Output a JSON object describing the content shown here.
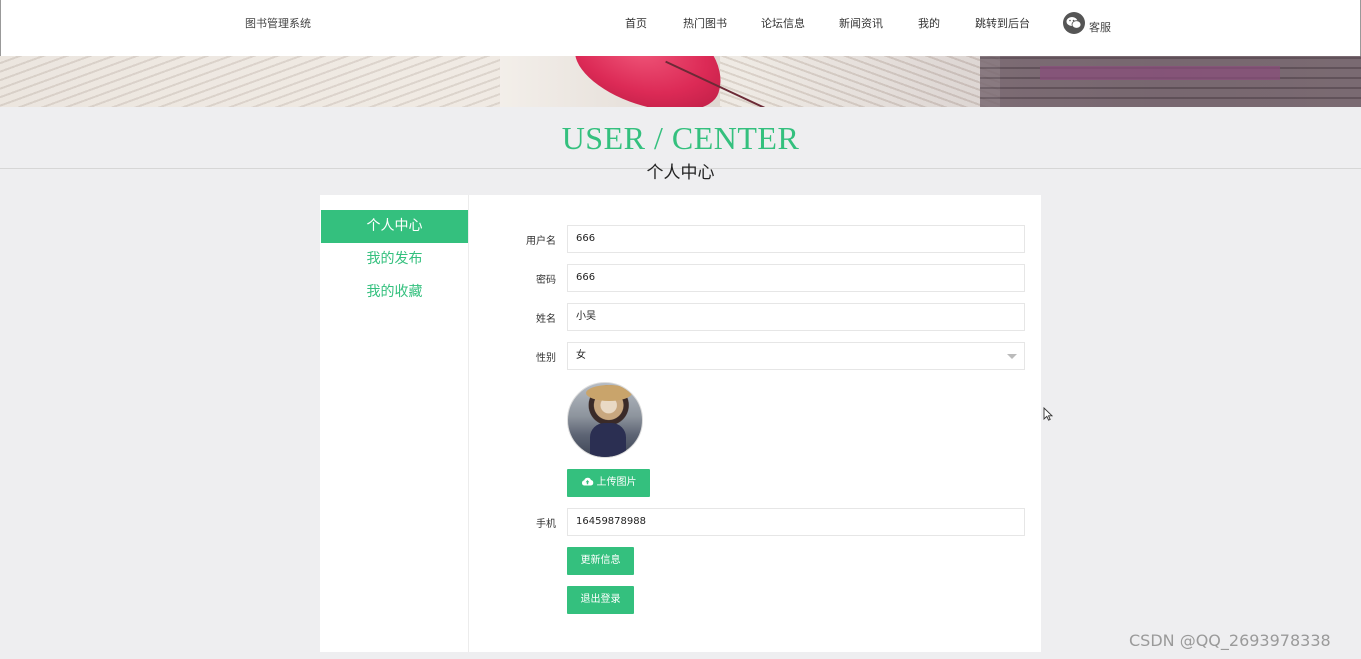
{
  "header": {
    "site_title": "图书管理系统",
    "nav": [
      "首页",
      "热门图书",
      "论坛信息",
      "新闻资讯",
      "我的",
      "跳转到后台"
    ],
    "service_label": "客服",
    "service_icon": "wechat-icon"
  },
  "heading": {
    "en": "USER / CENTER",
    "cn": "个人中心"
  },
  "sidebar": {
    "items": [
      {
        "label": "个人中心",
        "active": true
      },
      {
        "label": "我的发布",
        "active": false
      },
      {
        "label": "我的收藏",
        "active": false
      }
    ]
  },
  "form": {
    "username": {
      "label": "用户名",
      "value": "666"
    },
    "password": {
      "label": "密码",
      "value": "666"
    },
    "name": {
      "label": "姓名",
      "value": "小吴"
    },
    "gender": {
      "label": "性别",
      "value": "女"
    },
    "upload_button": "上传图片",
    "upload_icon": "cloud-upload-icon",
    "phone": {
      "label": "手机",
      "value": "16459878988"
    },
    "update_button": "更新信息",
    "logout_button": "退出登录"
  },
  "accent_color": "#34c07e",
  "watermark": "CSDN @QQ_2693978338"
}
